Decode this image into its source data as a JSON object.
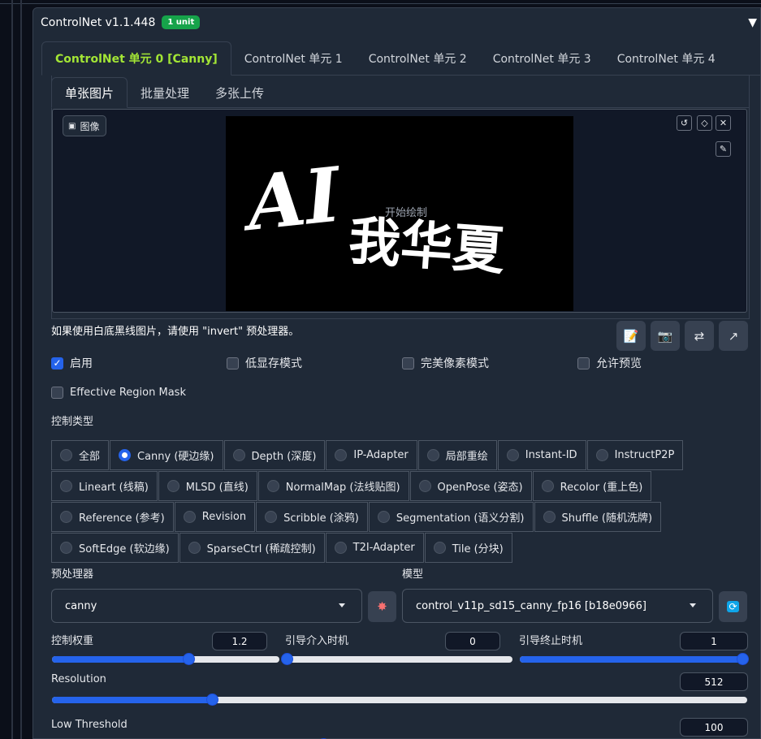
{
  "header": {
    "title": "ControlNet v1.1.448",
    "badge": "1 unit",
    "collapse_icon": "▼"
  },
  "unit_tabs": [
    "ControlNet 单元 0 [Canny]",
    "ControlNet 单元 1",
    "ControlNet 单元 2",
    "ControlNet 单元 3",
    "ControlNet 单元 4"
  ],
  "image_tabs": [
    "单张图片",
    "批量处理",
    "多张上传"
  ],
  "image": {
    "label": "图像",
    "overlay_text": "开始绘制",
    "art_text": "AI",
    "art_text2": "我华夏"
  },
  "hint": "如果使用白底黑线图片，请使用 \"invert\" 预处理器。",
  "checkboxes": [
    {
      "label": "启用",
      "checked": true
    },
    {
      "label": "低显存模式",
      "checked": false
    },
    {
      "label": "完美像素模式",
      "checked": false
    },
    {
      "label": "允许预览",
      "checked": false
    }
  ],
  "effective_region": {
    "label": "Effective Region Mask",
    "checked": false
  },
  "control_type": {
    "label": "控制类型",
    "selected": "Canny (硬边缘)",
    "rows": [
      [
        "全部",
        "Canny (硬边缘)",
        "Depth (深度)",
        "IP-Adapter",
        "局部重绘",
        "Instant-ID",
        "InstructP2P"
      ],
      [
        "Lineart (线稿)",
        "MLSD (直线)",
        "NormalMap (法线贴图)",
        "OpenPose (姿态)",
        "Recolor (重上色)"
      ],
      [
        "Reference (参考)",
        "Revision",
        "Scribble (涂鸦)",
        "Segmentation (语义分割)",
        "Shuffle (随机洗牌)"
      ],
      [
        "SoftEdge (软边缘)",
        "SparseCtrl (稀疏控制)",
        "T2I-Adapter",
        "Tile (分块)"
      ]
    ]
  },
  "preprocessor": {
    "label": "预处理器",
    "value": "canny"
  },
  "model": {
    "label": "模型",
    "value": "control_v11p_sd15_canny_fp16 [b18e0966]"
  },
  "sliders": {
    "weight": {
      "label": "控制权重",
      "value": "1.2",
      "fraction": 0.6
    },
    "start": {
      "label": "引导介入时机",
      "value": "0",
      "fraction": 0.0
    },
    "end": {
      "label": "引导终止时机",
      "value": "1",
      "fraction": 1.0
    },
    "resolution": {
      "label": "Resolution",
      "value": "512",
      "fraction": 0.23
    },
    "low": {
      "label": "Low Threshold",
      "value": "100",
      "fraction": 0.39
    }
  },
  "colors": {
    "accent": "#2563eb",
    "active_tab": "#a3e635",
    "badge": "#16a34a"
  }
}
